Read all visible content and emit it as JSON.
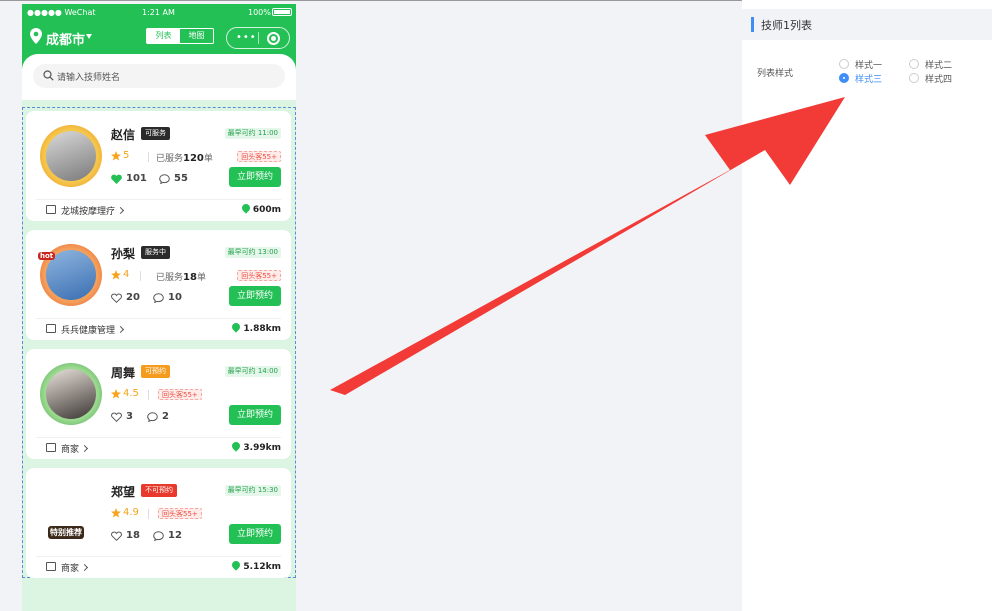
{
  "status_bar": {
    "carrier": "●●●●● WeChat",
    "time": "1:21 AM",
    "battery": "100%"
  },
  "nav": {
    "city": "成都市",
    "view_list": "列表",
    "view_map": "地图",
    "capsule_dots": "•••"
  },
  "search": {
    "placeholder": "请输入技师姓名"
  },
  "technicians": [
    {
      "name": "赵信",
      "status": "可服务",
      "status_color": "#2b2b2b",
      "earliest": "最早可约 11:00",
      "rating": "5",
      "served_prefix": "已服务",
      "served_count": "120",
      "served_suffix": "单",
      "coupon": "回头客55+",
      "likes": "101",
      "comments": "55",
      "book": "立即预约",
      "shop": "龙城按摩理疗",
      "distance": "600m",
      "liked": true
    },
    {
      "name": "孙梨",
      "status": "服务中",
      "status_color": "#2b2b2b",
      "earliest": "最早可约 13:00",
      "rating": "4",
      "served_prefix": "已服务",
      "served_count": "18",
      "served_suffix": "单",
      "coupon": "回头客55+",
      "likes": "20",
      "comments": "10",
      "book": "立即预约",
      "shop": "兵兵健康管理",
      "distance": "1.88km",
      "liked": false
    },
    {
      "name": "周舞",
      "status": "可预约",
      "status_color": "#f59c1f",
      "earliest": "最早可约 14:00",
      "rating": "4.5",
      "served_prefix": "",
      "served_count": "",
      "served_suffix": "",
      "coupon": "回头客55+",
      "likes": "3",
      "comments": "2",
      "book": "立即预约",
      "shop": "商家",
      "distance": "3.99km",
      "liked": false
    },
    {
      "name": "郑望",
      "status": "不可预约",
      "status_color": "#e8392c",
      "earliest": "最早可约 15:30",
      "rating": "4.9",
      "served_prefix": "",
      "served_count": "",
      "served_suffix": "",
      "coupon": "回头客55+",
      "likes": "18",
      "comments": "12",
      "book": "立即预约",
      "shop": "商家",
      "distance": "5.12km",
      "liked": false
    }
  ],
  "avatar_badges": {
    "first": "",
    "second": "hot",
    "third": "",
    "fourth": "特别推荐"
  },
  "panel": {
    "title": "技师1列表",
    "field_label": "列表样式",
    "options": [
      "样式一",
      "样式二",
      "样式三",
      "样式四"
    ],
    "selected": "样式三"
  },
  "colors": {
    "brand_green": "#23c056",
    "accent_blue": "#3e8ef7",
    "arrow_red": "#f23a36"
  }
}
